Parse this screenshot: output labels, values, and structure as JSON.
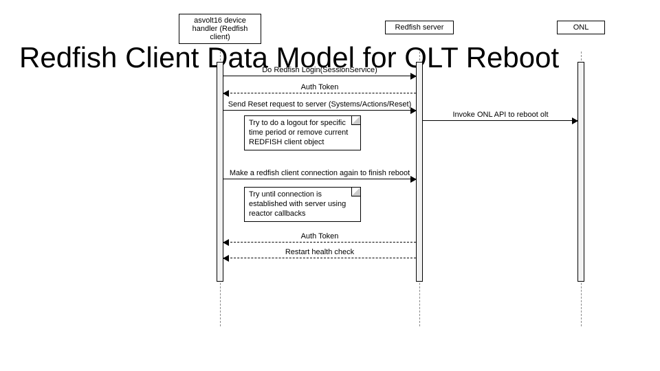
{
  "title": "Redfish Client Data Model for OLT Reboot",
  "participants": {
    "client": "asvolt16 device handler (Redfish client)",
    "server": "Redfish server",
    "onl": "ONL"
  },
  "messages": {
    "m1": "Do Redfish Login(SessionService)",
    "m2": "Auth Token",
    "m3": "Send Reset request to server (Systems/Actions/Reset)",
    "m4": "Invoke ONL API to reboot olt",
    "m5": "Make a redfish client connection again to finish reboot",
    "m6": "Auth Token",
    "m7": "Restart health check"
  },
  "notes": {
    "n1": "Try to do a logout  for specific time period or remove current REDFISH client object",
    "n2": "Try until connection is established with server using reactor callbacks"
  }
}
